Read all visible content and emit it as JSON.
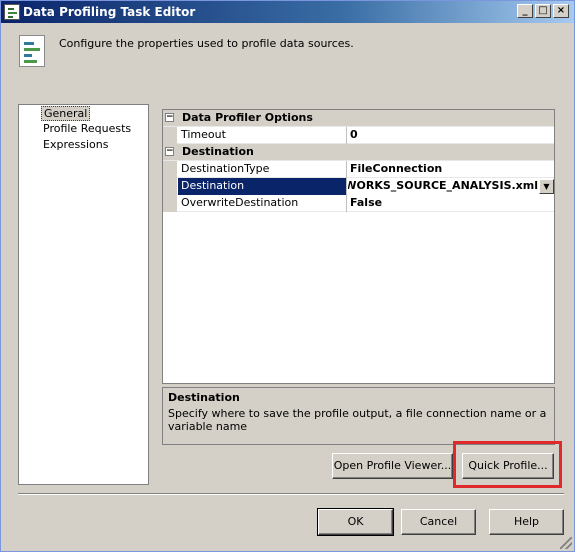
{
  "window": {
    "title": "Data Profiling Task Editor",
    "controls": {
      "minimize": "_",
      "maximize": "□",
      "close": "×"
    }
  },
  "header": {
    "description": "Configure the properties used to profile data sources."
  },
  "nav": {
    "items": [
      {
        "label": "General",
        "selected": true
      },
      {
        "label": "Profile Requests",
        "selected": false
      },
      {
        "label": "Expressions",
        "selected": false
      }
    ]
  },
  "property_grid": {
    "categories": [
      {
        "label": "Data Profiler Options",
        "expander": "⊟",
        "properties": [
          {
            "name": "Timeout",
            "value": "0"
          }
        ]
      },
      {
        "label": "Destination",
        "expander": "⊟",
        "properties": [
          {
            "name": "DestinationType",
            "value": "FileConnection"
          },
          {
            "name": "Destination",
            "value": "REWORKS_SOURCE_ANALYSIS.xml",
            "selected": true
          },
          {
            "name": "OverwriteDestination",
            "value": "False"
          }
        ]
      }
    ]
  },
  "description_panel": {
    "title": "Destination",
    "text": "Specify where to save the profile output, a file connection name or a variable name"
  },
  "buttons": {
    "open_profile_viewer": "Open Profile Viewer...",
    "quick_profile": "Quick Profile...",
    "ok": "OK",
    "cancel": "Cancel",
    "help": "Help"
  },
  "colors": {
    "titlebar_start": "#0a246a",
    "selection": "#0a246a",
    "highlight_box": "#e0292a",
    "dialog_bg": "#d4d0c8"
  }
}
